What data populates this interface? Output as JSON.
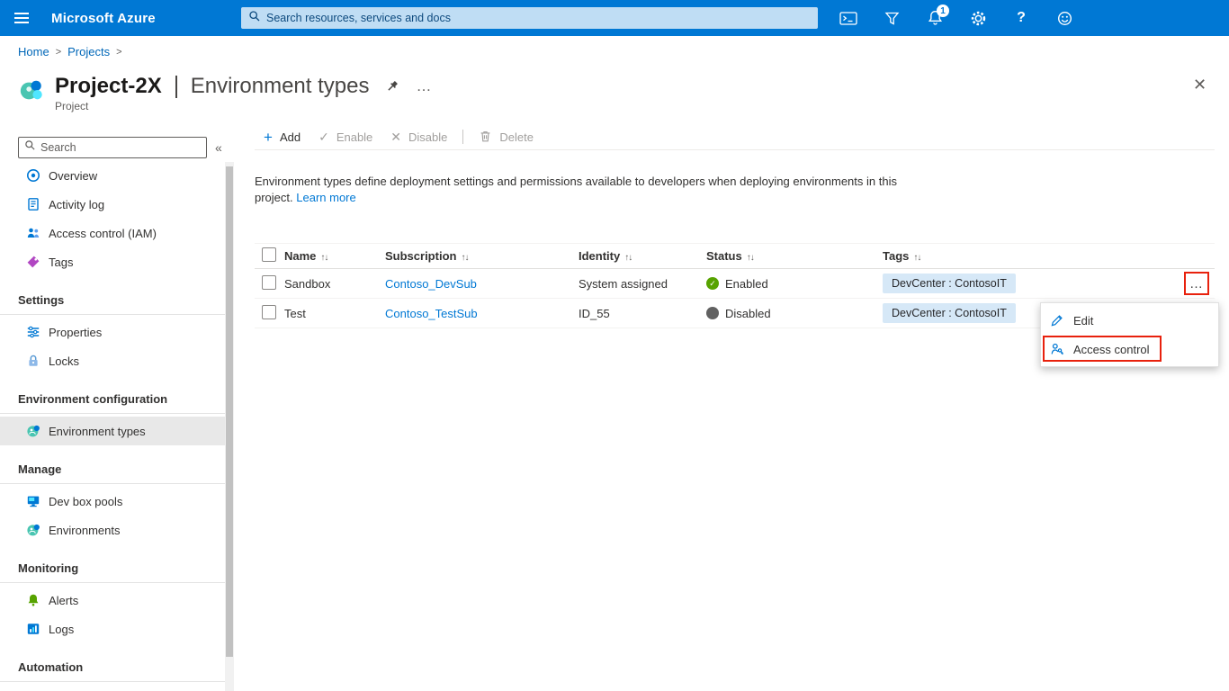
{
  "topbar": {
    "app_title": "Microsoft Azure",
    "search_placeholder": "Search resources, services and docs",
    "notification_count": "1"
  },
  "glyphs": {
    "breadcrumb_sep": ">",
    "ellipsis": "…",
    "close": "✕",
    "collapse": "«",
    "add": "+",
    "enable_check": "✓",
    "disable_x": "✕",
    "sort": "↑↓",
    "check": "✓",
    "help": "?"
  },
  "breadcrumb": {
    "items": [
      "Home",
      "Projects"
    ]
  },
  "header": {
    "title": "Project-2X",
    "subtitle": "Environment types",
    "resource_type": "Project"
  },
  "sidebar": {
    "search_placeholder": "Search",
    "groups": [
      {
        "heading": "",
        "items": [
          {
            "label": "Overview"
          },
          {
            "label": "Activity log"
          },
          {
            "label": "Access control (IAM)"
          },
          {
            "label": "Tags"
          }
        ]
      },
      {
        "heading": "Settings",
        "items": [
          {
            "label": "Properties"
          },
          {
            "label": "Locks"
          }
        ]
      },
      {
        "heading": "Environment configuration",
        "items": [
          {
            "label": "Environment types",
            "selected": true
          }
        ]
      },
      {
        "heading": "Manage",
        "items": [
          {
            "label": "Dev box pools"
          },
          {
            "label": "Environments"
          }
        ]
      },
      {
        "heading": "Monitoring",
        "items": [
          {
            "label": "Alerts"
          },
          {
            "label": "Logs"
          }
        ]
      },
      {
        "heading": "Automation",
        "items": []
      }
    ]
  },
  "toolbar": {
    "add": "Add",
    "enable": "Enable",
    "disable": "Disable",
    "delete": "Delete"
  },
  "description": {
    "text": "Environment types define deployment settings and permissions available to developers when deploying environments in this project.",
    "link_label": "Learn more"
  },
  "table": {
    "columns": [
      "Name",
      "Subscription",
      "Identity",
      "Status",
      "Tags"
    ],
    "rows": [
      {
        "name": "Sandbox",
        "subscription": "Contoso_DevSub",
        "identity": "System assigned",
        "status": "Enabled",
        "tag": "DevCenter : ContosoIT"
      },
      {
        "name": "Test",
        "subscription": "Contoso_TestSub",
        "identity": "ID_55",
        "status": "Disabled",
        "tag": "DevCenter : ContosoIT"
      }
    ]
  },
  "context_menu": {
    "edit_label": "Edit",
    "access_control_label": "Access control"
  },
  "colors": {
    "topbar": "#0078d4",
    "link": "#0078d4",
    "status_enabled": "#57a300",
    "status_disabled": "#616161",
    "tag_chip_background": "#d6e8f7",
    "annotation_highlight": "#e8210d",
    "selected_nav_background": "#e8e8e8"
  }
}
